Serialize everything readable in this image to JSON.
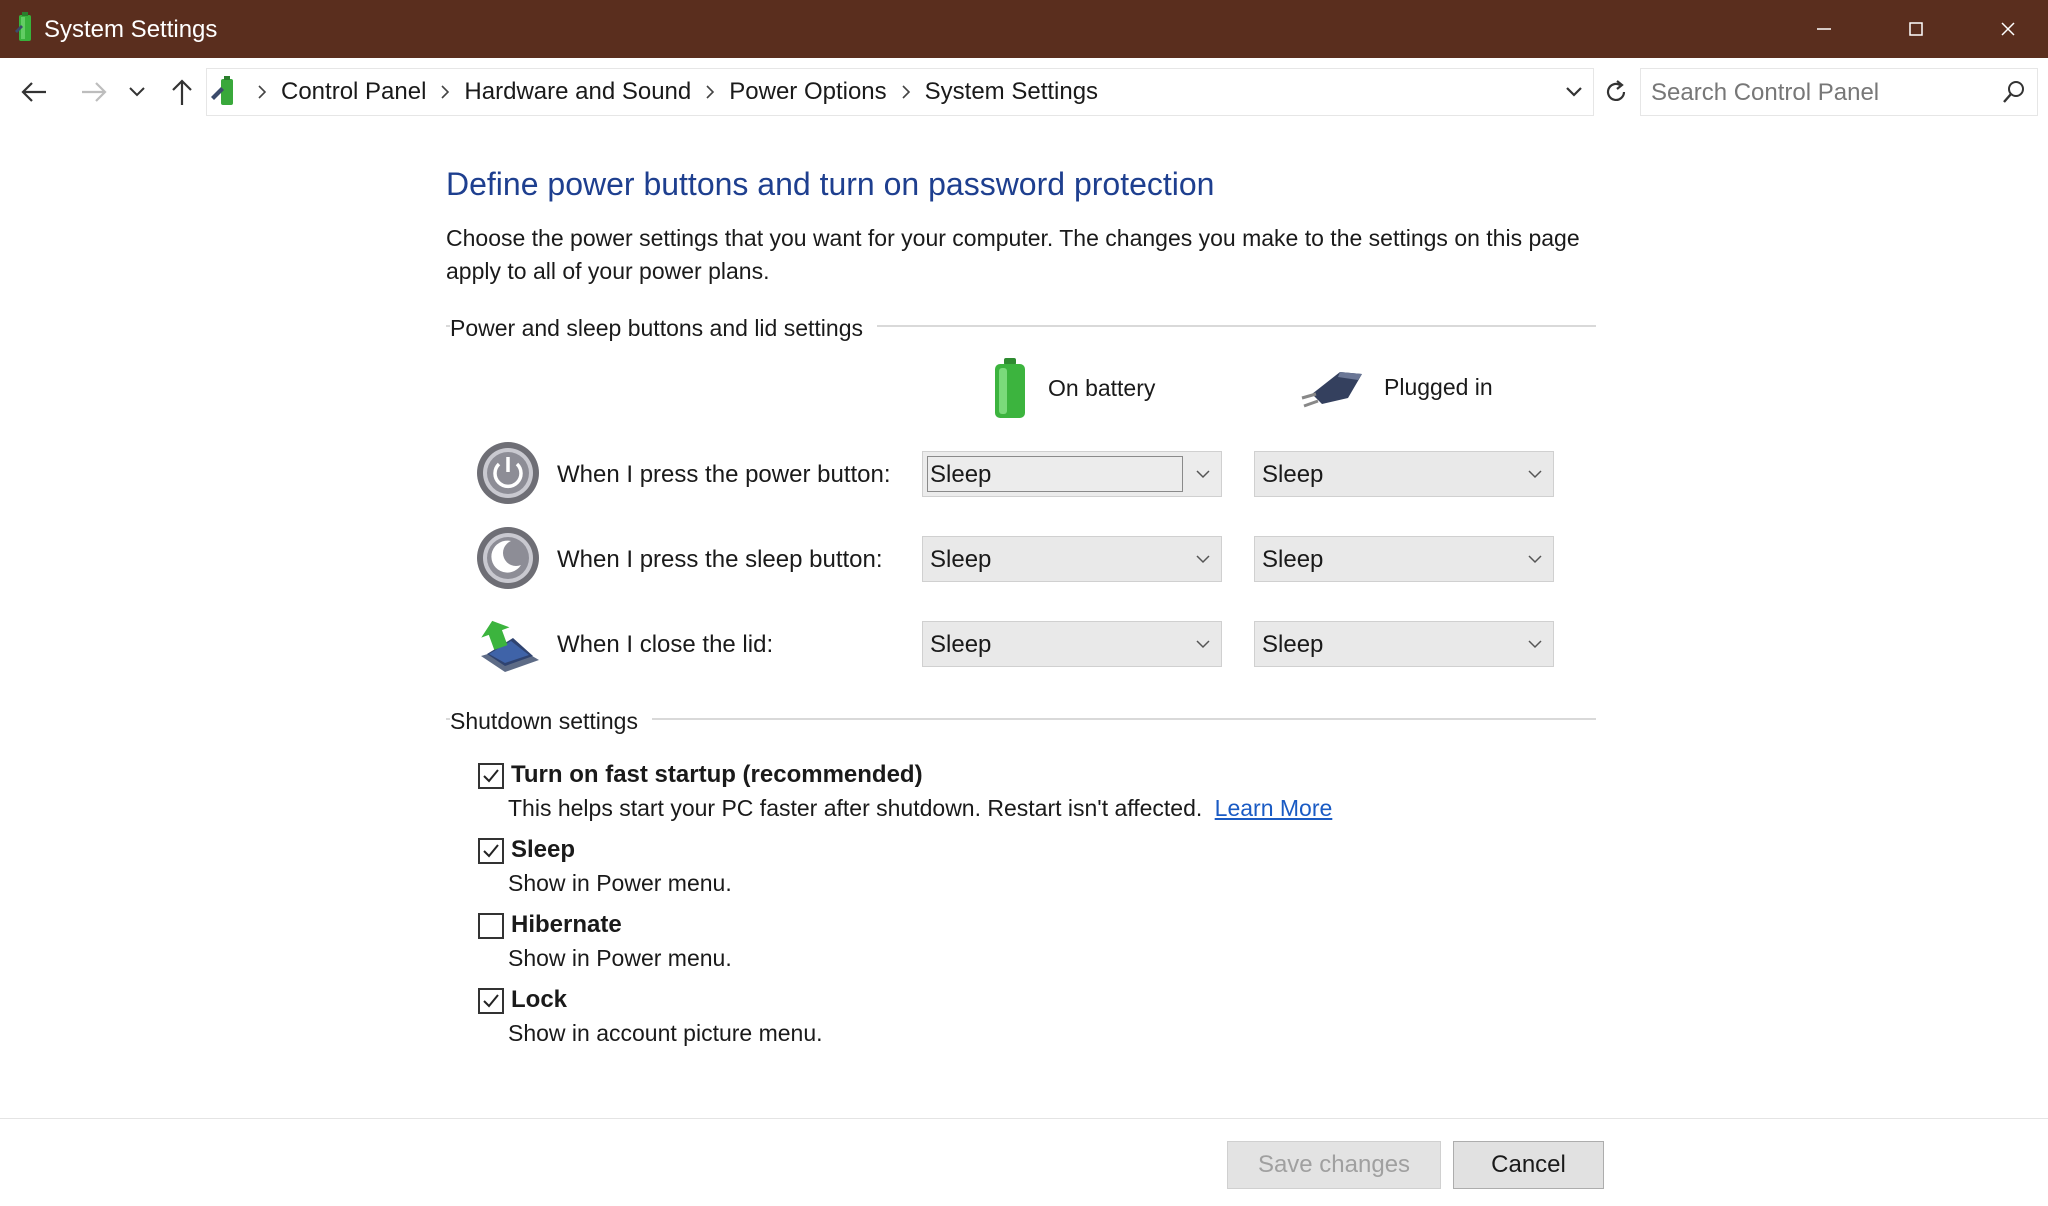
{
  "window": {
    "title": "System Settings",
    "controls": {
      "minimize": "minimize-icon",
      "maximize": "maximize-icon",
      "close": "close-icon"
    },
    "titlebar_color": "#5a2e1e"
  },
  "navigation": {
    "breadcrumb": [
      "Control Panel",
      "Hardware and Sound",
      "Power Options",
      "System Settings"
    ],
    "search_placeholder": "Search Control Panel"
  },
  "page": {
    "heading": "Define power buttons and turn on password protection",
    "description": "Choose the power settings that you want for your computer. The changes you make to the settings on this page apply to all of your power plans.",
    "heading_color": "#1e3f8f"
  },
  "power_section": {
    "label": "Power and sleep buttons and lid settings",
    "columns": {
      "battery": "On battery",
      "plugged": "Plugged in"
    },
    "rows": [
      {
        "label": "When I press the power button:",
        "battery": "Sleep",
        "plugged": "Sleep",
        "icon": "power-button-icon"
      },
      {
        "label": "When I press the sleep button:",
        "battery": "Sleep",
        "plugged": "Sleep",
        "icon": "sleep-button-icon"
      },
      {
        "label": "When I close the lid:",
        "battery": "Sleep",
        "plugged": "Sleep",
        "icon": "laptop-lid-icon"
      }
    ]
  },
  "shutdown_section": {
    "label": "Shutdown settings",
    "options": [
      {
        "title": "Turn on fast startup (recommended)",
        "description": "This helps start your PC faster after shutdown. Restart isn't affected.",
        "link": "Learn More",
        "checked": true
      },
      {
        "title": "Sleep",
        "description": "Show in Power menu.",
        "checked": true
      },
      {
        "title": "Hibernate",
        "description": "Show in Power menu.",
        "checked": false
      },
      {
        "title": "Lock",
        "description": "Show in account picture menu.",
        "checked": true
      }
    ]
  },
  "footer": {
    "save_label": "Save changes",
    "cancel_label": "Cancel"
  }
}
